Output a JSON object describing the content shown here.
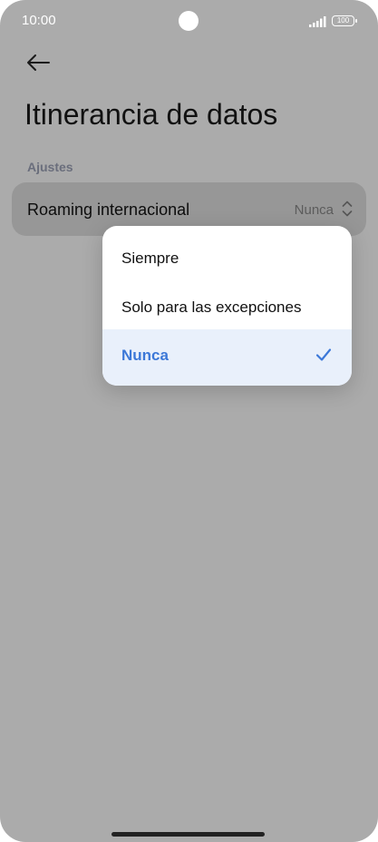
{
  "status_bar": {
    "time": "10:00",
    "battery": "100",
    "battery_icon": "battery-icon",
    "signal_icon": "signal-icon"
  },
  "header": {
    "back_icon": "back-arrow-icon",
    "title": "Itinerancia de datos"
  },
  "settings": {
    "section_label": "Ajustes",
    "roaming": {
      "label": "Roaming internacional",
      "value": "Nunca",
      "icon": "up-down-chevron-icon"
    }
  },
  "dropdown": {
    "options": [
      {
        "label": "Siempre",
        "selected": false
      },
      {
        "label": "Solo para las excepciones",
        "selected": false
      },
      {
        "label": "Nunca",
        "selected": true
      }
    ],
    "check_icon": "checkmark-icon"
  },
  "colors": {
    "accent": "#3c78d8",
    "scrim_background": "#ababab",
    "selected_row": "#e9f0fb"
  }
}
